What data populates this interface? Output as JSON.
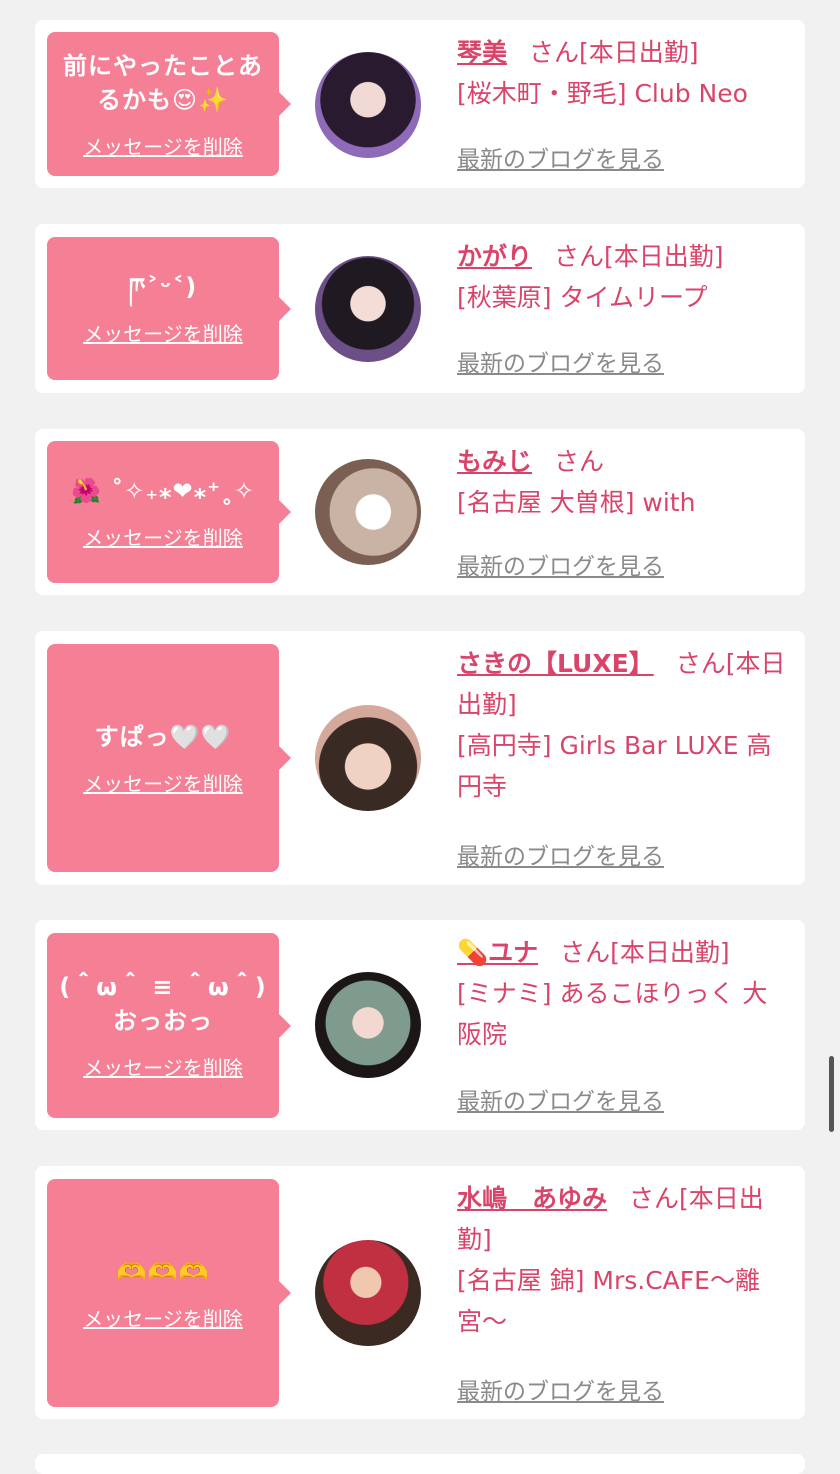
{
  "theme": {
    "accent": "#f57f95",
    "name_color": "#d9456a",
    "link_color": "#8a8a8a"
  },
  "cards": [
    {
      "message": "前にやったことあるかも😍✨",
      "delete_label": "メッセージを削除",
      "name": "琴美",
      "suffix": "さん[本日出勤]",
      "shop": "[桜木町・野毛] Club Neo",
      "blog_label": "最新のブログを見る",
      "avatar_colors": [
        "#8e6ab8",
        "#2a1a2f"
      ]
    },
    {
      "message": "ཫ˃ᵕ˂)",
      "delete_label": "メッセージを削除",
      "name": "かがり",
      "suffix": "さん[本日出勤]",
      "shop": "[秋葉原] タイムリープ",
      "blog_label": "最新のブログを見る",
      "avatar_colors": [
        "#4a3b5e",
        "#d8c6c0"
      ]
    },
    {
      "message": "🌺 ˚✧₊⁎❤︎⁎⁺˳✧",
      "delete_label": "メッセージを削除",
      "name": "もみじ",
      "suffix": "さん",
      "shop": "[名古屋 大曽根] with",
      "blog_label": "最新のブログを見る",
      "avatar_colors": [
        "#c9b3a5",
        "#7a5f52"
      ]
    },
    {
      "message": "すぱっ🤍🤍",
      "delete_label": "メッセージを削除",
      "name": "さきの【LUXE】",
      "suffix": "さん[本日出勤]",
      "shop": "[高円寺] Girls Bar LUXE 高円寺",
      "blog_label": "最新のブログを見る",
      "avatar_colors": [
        "#d4a89a",
        "#3a2a24"
      ]
    },
    {
      "message": "(＾ω＾ ≡ ＾ω＾) おっおっ",
      "delete_label": "メッセージを削除",
      "name": "💊ユナ",
      "suffix": "さん[本日出勤]",
      "shop": "[ミナミ] あるこほりっく 大阪院",
      "blog_label": "最新のブログを見る",
      "avatar_colors": [
        "#7e9b8d",
        "#c0304a"
      ]
    },
    {
      "message": "🫶🫶🫶",
      "delete_label": "メッセージを削除",
      "name": "水嶋　あゆみ",
      "suffix": "さん[本日出勤]",
      "shop": "[名古屋 錦] Mrs.CAFE〜離宮〜",
      "blog_label": "最新のブログを見る",
      "avatar_colors": [
        "#c03040",
        "#3b2a22"
      ]
    }
  ]
}
